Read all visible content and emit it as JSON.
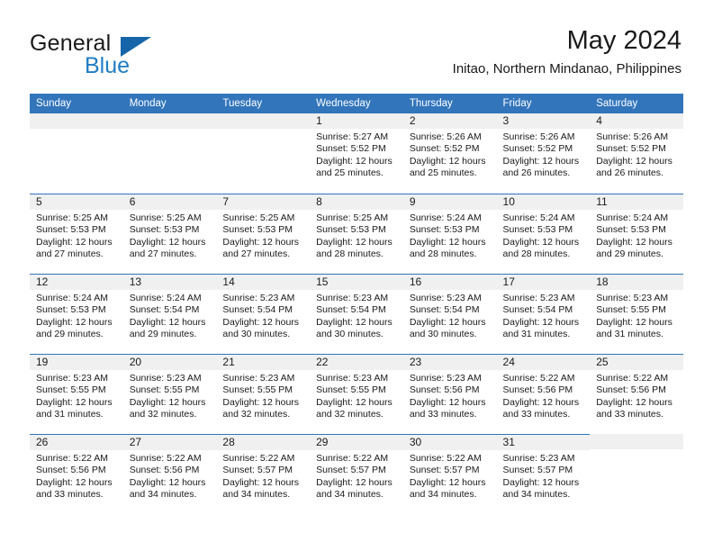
{
  "brand": {
    "name_part1": "General",
    "name_part2": "Blue",
    "mark": "triangle-icon",
    "accent_color": "#1f7dc4",
    "mark_color": "#1565a8"
  },
  "header": {
    "month_title": "May 2024",
    "location": "Initao, Northern Mindanao, Philippines"
  },
  "calendar": {
    "header_bg": "#3275bb",
    "daynum_bg": "#f0f0f0",
    "weekdays": [
      "Sunday",
      "Monday",
      "Tuesday",
      "Wednesday",
      "Thursday",
      "Friday",
      "Saturday"
    ],
    "weeks": [
      [
        {
          "day": "",
          "blank": true
        },
        {
          "day": "",
          "blank": true
        },
        {
          "day": "",
          "blank": true
        },
        {
          "day": "1",
          "sunrise": "Sunrise: 5:27 AM",
          "sunset": "Sunset: 5:52 PM",
          "daylight_line1": "Daylight: 12 hours",
          "daylight_line2": "and 25 minutes."
        },
        {
          "day": "2",
          "sunrise": "Sunrise: 5:26 AM",
          "sunset": "Sunset: 5:52 PM",
          "daylight_line1": "Daylight: 12 hours",
          "daylight_line2": "and 25 minutes."
        },
        {
          "day": "3",
          "sunrise": "Sunrise: 5:26 AM",
          "sunset": "Sunset: 5:52 PM",
          "daylight_line1": "Daylight: 12 hours",
          "daylight_line2": "and 26 minutes."
        },
        {
          "day": "4",
          "sunrise": "Sunrise: 5:26 AM",
          "sunset": "Sunset: 5:52 PM",
          "daylight_line1": "Daylight: 12 hours",
          "daylight_line2": "and 26 minutes."
        }
      ],
      [
        {
          "day": "5",
          "sunrise": "Sunrise: 5:25 AM",
          "sunset": "Sunset: 5:53 PM",
          "daylight_line1": "Daylight: 12 hours",
          "daylight_line2": "and 27 minutes."
        },
        {
          "day": "6",
          "sunrise": "Sunrise: 5:25 AM",
          "sunset": "Sunset: 5:53 PM",
          "daylight_line1": "Daylight: 12 hours",
          "daylight_line2": "and 27 minutes."
        },
        {
          "day": "7",
          "sunrise": "Sunrise: 5:25 AM",
          "sunset": "Sunset: 5:53 PM",
          "daylight_line1": "Daylight: 12 hours",
          "daylight_line2": "and 27 minutes."
        },
        {
          "day": "8",
          "sunrise": "Sunrise: 5:25 AM",
          "sunset": "Sunset: 5:53 PM",
          "daylight_line1": "Daylight: 12 hours",
          "daylight_line2": "and 28 minutes."
        },
        {
          "day": "9",
          "sunrise": "Sunrise: 5:24 AM",
          "sunset": "Sunset: 5:53 PM",
          "daylight_line1": "Daylight: 12 hours",
          "daylight_line2": "and 28 minutes."
        },
        {
          "day": "10",
          "sunrise": "Sunrise: 5:24 AM",
          "sunset": "Sunset: 5:53 PM",
          "daylight_line1": "Daylight: 12 hours",
          "daylight_line2": "and 28 minutes."
        },
        {
          "day": "11",
          "sunrise": "Sunrise: 5:24 AM",
          "sunset": "Sunset: 5:53 PM",
          "daylight_line1": "Daylight: 12 hours",
          "daylight_line2": "and 29 minutes."
        }
      ],
      [
        {
          "day": "12",
          "sunrise": "Sunrise: 5:24 AM",
          "sunset": "Sunset: 5:53 PM",
          "daylight_line1": "Daylight: 12 hours",
          "daylight_line2": "and 29 minutes."
        },
        {
          "day": "13",
          "sunrise": "Sunrise: 5:24 AM",
          "sunset": "Sunset: 5:54 PM",
          "daylight_line1": "Daylight: 12 hours",
          "daylight_line2": "and 29 minutes."
        },
        {
          "day": "14",
          "sunrise": "Sunrise: 5:23 AM",
          "sunset": "Sunset: 5:54 PM",
          "daylight_line1": "Daylight: 12 hours",
          "daylight_line2": "and 30 minutes."
        },
        {
          "day": "15",
          "sunrise": "Sunrise: 5:23 AM",
          "sunset": "Sunset: 5:54 PM",
          "daylight_line1": "Daylight: 12 hours",
          "daylight_line2": "and 30 minutes."
        },
        {
          "day": "16",
          "sunrise": "Sunrise: 5:23 AM",
          "sunset": "Sunset: 5:54 PM",
          "daylight_line1": "Daylight: 12 hours",
          "daylight_line2": "and 30 minutes."
        },
        {
          "day": "17",
          "sunrise": "Sunrise: 5:23 AM",
          "sunset": "Sunset: 5:54 PM",
          "daylight_line1": "Daylight: 12 hours",
          "daylight_line2": "and 31 minutes."
        },
        {
          "day": "18",
          "sunrise": "Sunrise: 5:23 AM",
          "sunset": "Sunset: 5:55 PM",
          "daylight_line1": "Daylight: 12 hours",
          "daylight_line2": "and 31 minutes."
        }
      ],
      [
        {
          "day": "19",
          "sunrise": "Sunrise: 5:23 AM",
          "sunset": "Sunset: 5:55 PM",
          "daylight_line1": "Daylight: 12 hours",
          "daylight_line2": "and 31 minutes."
        },
        {
          "day": "20",
          "sunrise": "Sunrise: 5:23 AM",
          "sunset": "Sunset: 5:55 PM",
          "daylight_line1": "Daylight: 12 hours",
          "daylight_line2": "and 32 minutes."
        },
        {
          "day": "21",
          "sunrise": "Sunrise: 5:23 AM",
          "sunset": "Sunset: 5:55 PM",
          "daylight_line1": "Daylight: 12 hours",
          "daylight_line2": "and 32 minutes."
        },
        {
          "day": "22",
          "sunrise": "Sunrise: 5:23 AM",
          "sunset": "Sunset: 5:55 PM",
          "daylight_line1": "Daylight: 12 hours",
          "daylight_line2": "and 32 minutes."
        },
        {
          "day": "23",
          "sunrise": "Sunrise: 5:23 AM",
          "sunset": "Sunset: 5:56 PM",
          "daylight_line1": "Daylight: 12 hours",
          "daylight_line2": "and 33 minutes."
        },
        {
          "day": "24",
          "sunrise": "Sunrise: 5:22 AM",
          "sunset": "Sunset: 5:56 PM",
          "daylight_line1": "Daylight: 12 hours",
          "daylight_line2": "and 33 minutes."
        },
        {
          "day": "25",
          "sunrise": "Sunrise: 5:22 AM",
          "sunset": "Sunset: 5:56 PM",
          "daylight_line1": "Daylight: 12 hours",
          "daylight_line2": "and 33 minutes."
        }
      ],
      [
        {
          "day": "26",
          "sunrise": "Sunrise: 5:22 AM",
          "sunset": "Sunset: 5:56 PM",
          "daylight_line1": "Daylight: 12 hours",
          "daylight_line2": "and 33 minutes."
        },
        {
          "day": "27",
          "sunrise": "Sunrise: 5:22 AM",
          "sunset": "Sunset: 5:56 PM",
          "daylight_line1": "Daylight: 12 hours",
          "daylight_line2": "and 34 minutes."
        },
        {
          "day": "28",
          "sunrise": "Sunrise: 5:22 AM",
          "sunset": "Sunset: 5:57 PM",
          "daylight_line1": "Daylight: 12 hours",
          "daylight_line2": "and 34 minutes."
        },
        {
          "day": "29",
          "sunrise": "Sunrise: 5:22 AM",
          "sunset": "Sunset: 5:57 PM",
          "daylight_line1": "Daylight: 12 hours",
          "daylight_line2": "and 34 minutes."
        },
        {
          "day": "30",
          "sunrise": "Sunrise: 5:22 AM",
          "sunset": "Sunset: 5:57 PM",
          "daylight_line1": "Daylight: 12 hours",
          "daylight_line2": "and 34 minutes."
        },
        {
          "day": "31",
          "sunrise": "Sunrise: 5:23 AM",
          "sunset": "Sunset: 5:57 PM",
          "daylight_line1": "Daylight: 12 hours",
          "daylight_line2": "and 34 minutes."
        },
        {
          "day": "",
          "blank": true
        }
      ]
    ]
  }
}
